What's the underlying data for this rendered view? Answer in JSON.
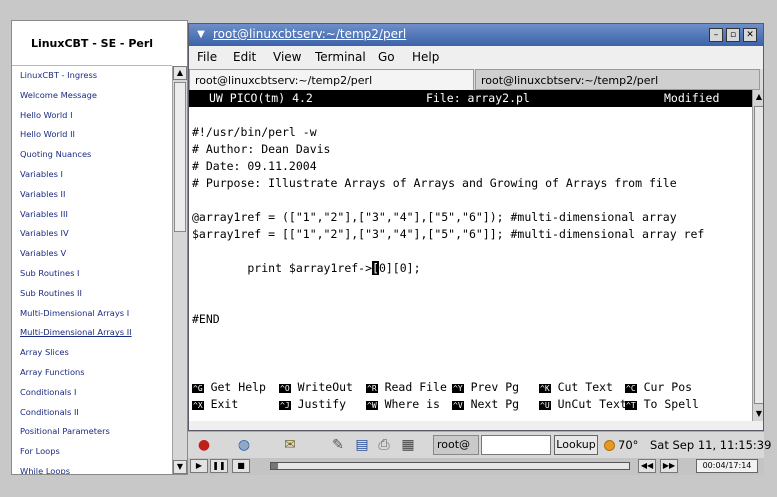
{
  "sidebar": {
    "title": "LinuxCBT - SE - Perl",
    "items": [
      {
        "label": "LinuxCBT - Ingress"
      },
      {
        "label": "Welcome Message"
      },
      {
        "label": "Hello World I"
      },
      {
        "label": "Hello World II"
      },
      {
        "label": "Quoting Nuances"
      },
      {
        "label": "Variables I"
      },
      {
        "label": "Variables II"
      },
      {
        "label": "Variables III"
      },
      {
        "label": "Variables IV"
      },
      {
        "label": "Variables V"
      },
      {
        "label": "Sub Routines I"
      },
      {
        "label": "Sub Routines II"
      },
      {
        "label": "Multi-Dimensional Arrays I"
      },
      {
        "label": "Multi-Dimensional Arrays II",
        "current": true
      },
      {
        "label": "Array Slices"
      },
      {
        "label": "Array Functions"
      },
      {
        "label": "Conditionals I"
      },
      {
        "label": "Conditionals II"
      },
      {
        "label": "Positional Parameters"
      },
      {
        "label": "For Loops"
      },
      {
        "label": "While Loops"
      }
    ]
  },
  "window": {
    "title": "root@linuxcbtserv:~/temp2/perl",
    "menus": [
      "File",
      "Edit",
      "View",
      "Terminal",
      "Go",
      "Help"
    ],
    "tabs": [
      "root@linuxcbtserv:~/temp2/perl",
      "root@linuxcbtserv:~/temp2/perl"
    ]
  },
  "editor": {
    "app": "UW PICO(tm) 4.2",
    "file_label": "File: array2.pl",
    "status": "Modified",
    "lines": [
      "",
      "#!/usr/bin/perl -w",
      "# Author: Dean Davis",
      "# Date: 09.11.2004",
      "# Purpose: Illustrate Arrays of Arrays and Growing of Arrays from file",
      "",
      "@array1ref = ([\"1\",\"2\"],[\"3\",\"4\"],[\"5\",\"6\"]); #multi-dimensional array",
      "$array1ref = [[\"1\",\"2\"],[\"3\",\"4\"],[\"5\",\"6\"]]; #multi-dimensional array ref",
      "",
      "        print $array1ref->",
      "",
      "",
      "#END"
    ],
    "cursor_char": "[",
    "cursor_rest": "0][0];",
    "shortcuts_row1": [
      {
        "key": "^G",
        "label": "Get Help"
      },
      {
        "key": "^O",
        "label": "WriteOut"
      },
      {
        "key": "^R",
        "label": "Read File"
      },
      {
        "key": "^Y",
        "label": "Prev Pg"
      },
      {
        "key": "^K",
        "label": "Cut Text"
      },
      {
        "key": "^C",
        "label": "Cur Pos"
      }
    ],
    "shortcuts_row2": [
      {
        "key": "^X",
        "label": "Exit"
      },
      {
        "key": "^J",
        "label": "Justify"
      },
      {
        "key": "^W",
        "label": "Where is"
      },
      {
        "key": "^V",
        "label": "Next Pg"
      },
      {
        "key": "^U",
        "label": "UnCut Text"
      },
      {
        "key": "^T",
        "label": "To Spell"
      }
    ]
  },
  "taskbar": {
    "task_label": "root@",
    "lookup_label": "Lookup",
    "temperature": "70°",
    "clock": "Sat Sep 11, 11:15:39"
  },
  "player": {
    "time": "00:04/17:14",
    "progress": 0.02
  },
  "icons": {
    "redhat": "redhat-icon",
    "browser": "globe-icon",
    "mail": "mail-icon"
  }
}
